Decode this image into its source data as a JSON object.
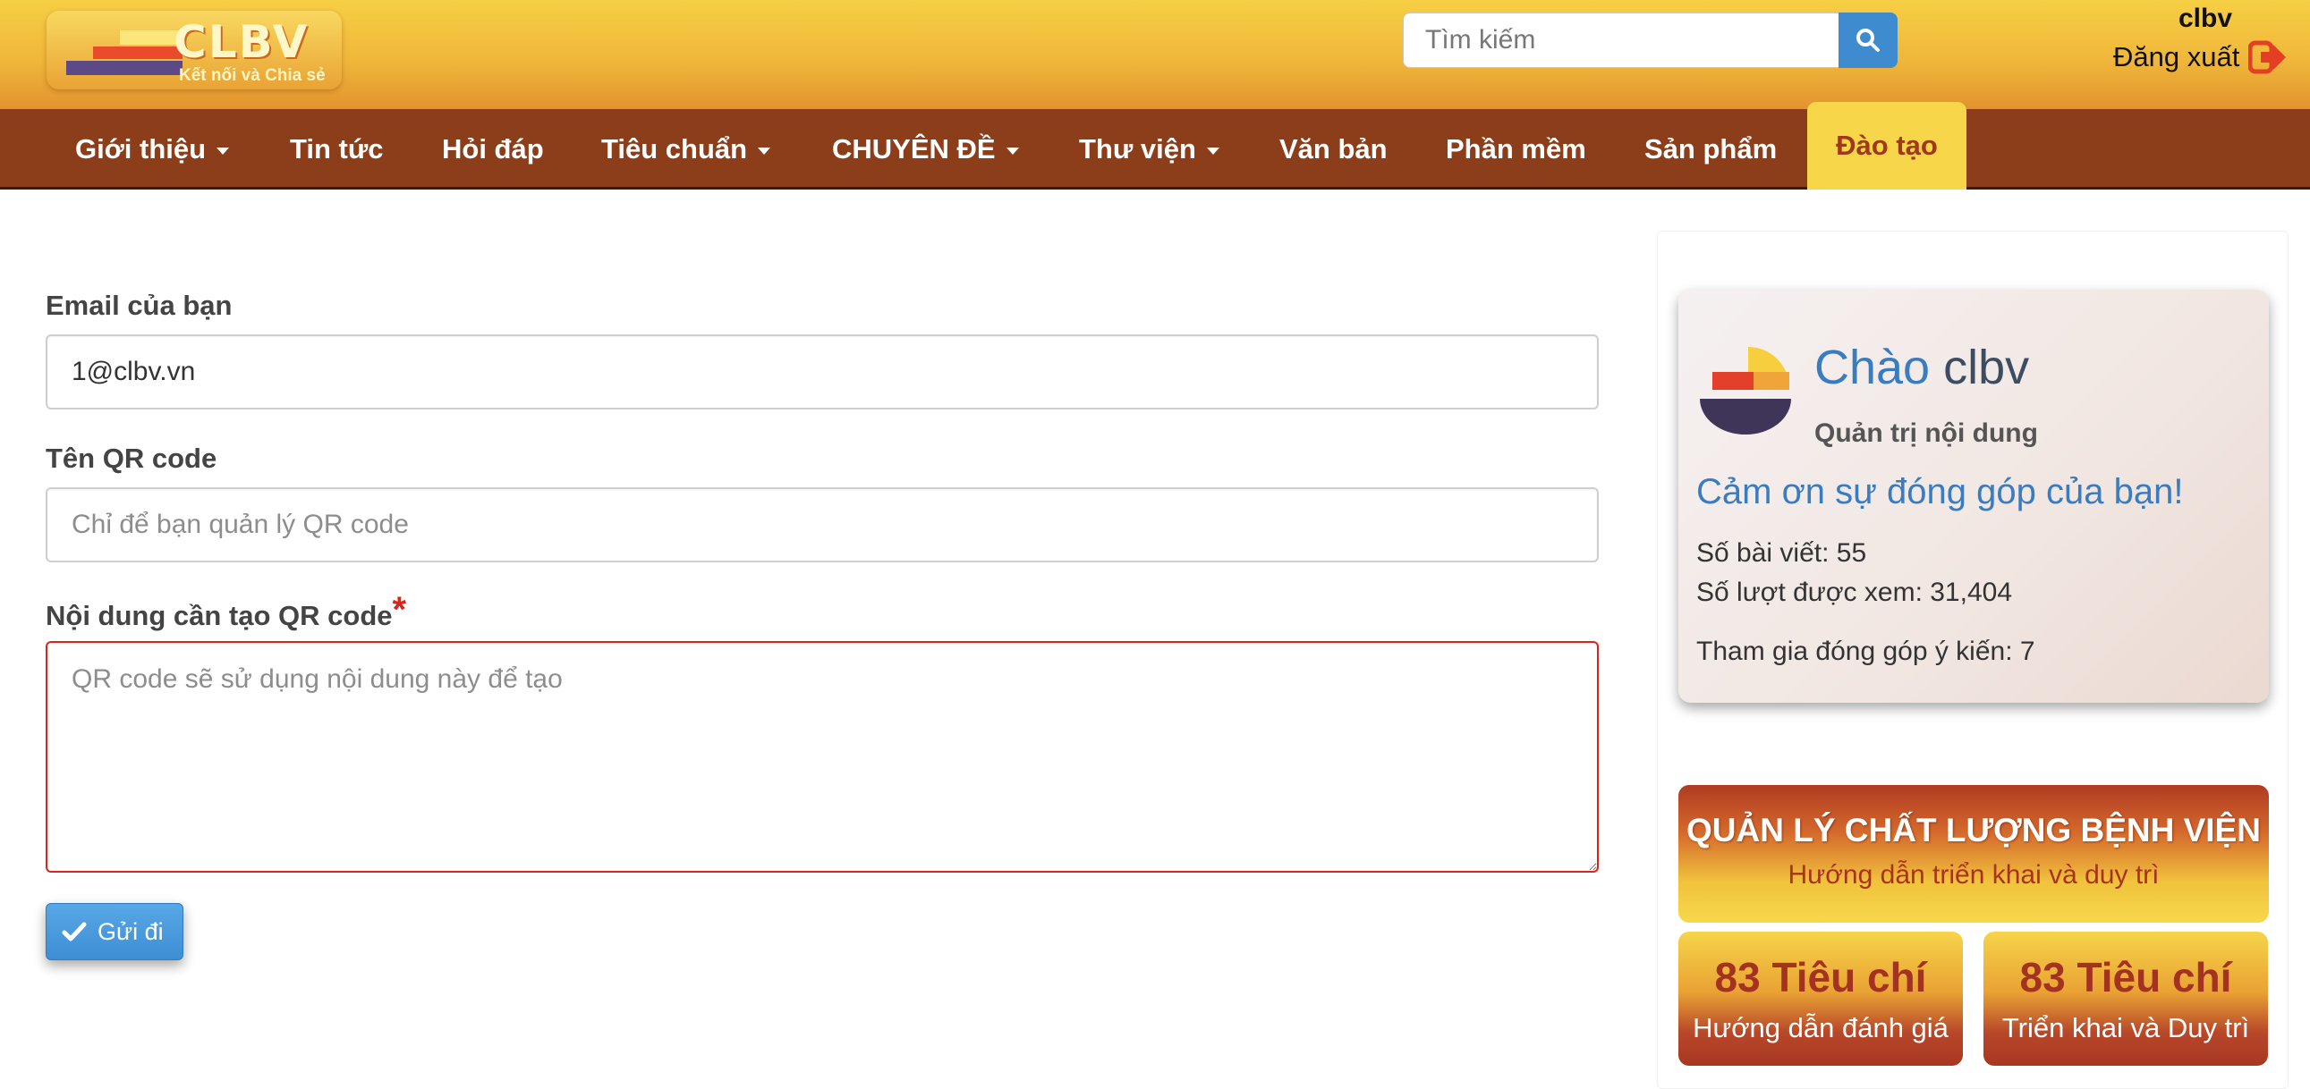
{
  "header": {
    "logo_text": "CLBV",
    "logo_slogan": "Kết nối và Chia sẻ",
    "search_placeholder": "Tìm kiếm",
    "user_name": "clbv",
    "logout_label": "Đăng xuất"
  },
  "nav": {
    "items": [
      {
        "label": "Giới thiệu",
        "dropdown": true
      },
      {
        "label": "Tin tức",
        "dropdown": false
      },
      {
        "label": "Hỏi đáp",
        "dropdown": false
      },
      {
        "label": "Tiêu chuẩn",
        "dropdown": true
      },
      {
        "label": "CHUYÊN ĐỀ",
        "dropdown": true
      },
      {
        "label": "Thư viện",
        "dropdown": true
      },
      {
        "label": "Văn bản",
        "dropdown": false
      },
      {
        "label": "Phần mềm",
        "dropdown": false
      },
      {
        "label": "Sản phẩm",
        "dropdown": false
      }
    ],
    "active_label": "Đào tạo"
  },
  "form": {
    "email_label": "Email của bạn",
    "email_value": "1@clbv.vn",
    "name_label": "Tên QR code",
    "name_placeholder": "Chỉ để bạn quản lý QR code",
    "content_label": "Nội dung cần tạo QR code",
    "required_mark": "*",
    "content_placeholder": "QR code sẽ sử dụng nội dung này để tạo",
    "submit_label": "Gửi đi"
  },
  "sidebar": {
    "welcome_word": "Chào",
    "welcome_name": "clbv",
    "role": "Quản trị nội dung",
    "thanks": "Cảm ơn sự đóng góp của bạn!",
    "posts": "Số bài viết: 55",
    "views": "Số lượt được xem: 31,404",
    "feedback": "Tham gia đóng góp ý kiến: 7",
    "banner_title": "QUẢN LÝ CHẤT LƯỢNG BỆNH VIỆN",
    "banner_sub": "Hướng dẫn triển khai và duy trì",
    "cards": [
      {
        "title": "83 Tiêu chí",
        "sub": "Hướng dẫn đánh giá"
      },
      {
        "title": "83 Tiêu chí",
        "sub": "Triển khai và Duy trì"
      }
    ]
  },
  "colors": {
    "nav_bg": "#8c3e1b",
    "accent_blue": "#3a7cc0",
    "required_red": "#d9261c",
    "active_tab": "#f7d749"
  }
}
